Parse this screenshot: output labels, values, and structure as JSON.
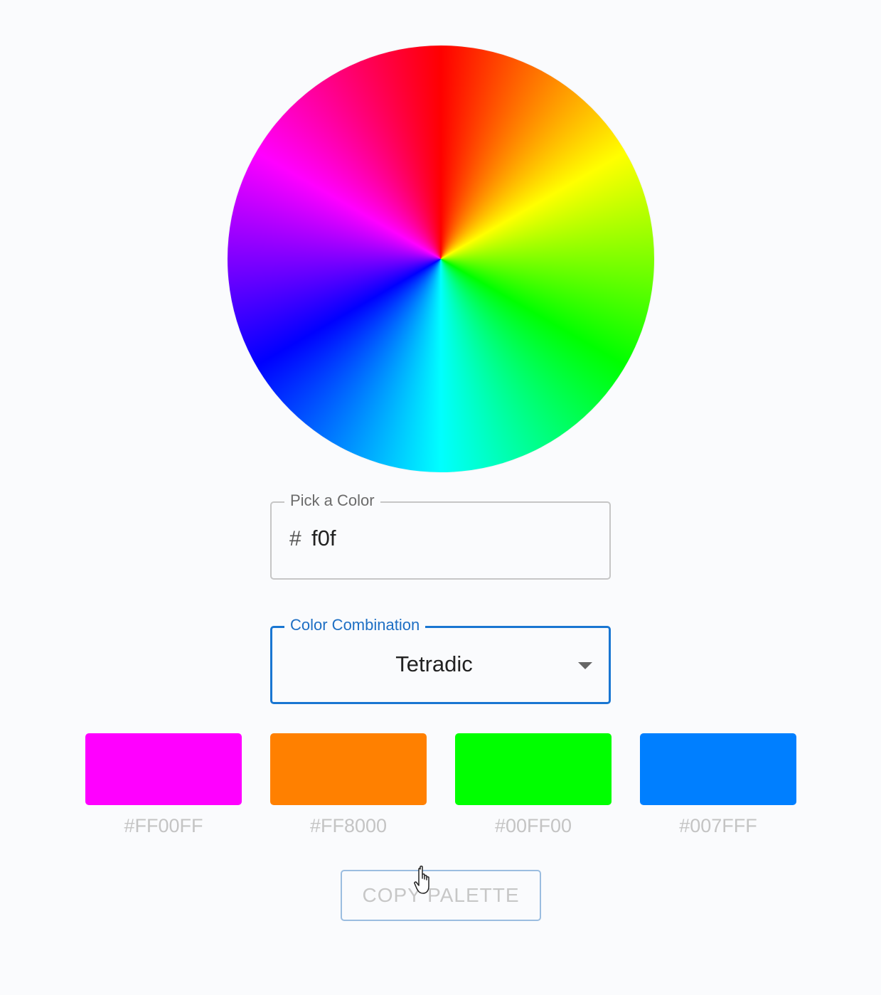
{
  "color_picker": {
    "legend": "Pick a Color",
    "prefix": "#",
    "value": "f0f"
  },
  "combination": {
    "legend": "Color Combination",
    "selected": "Tetradic"
  },
  "palette": [
    {
      "color": "#FF00FF",
      "label": "#FF00FF"
    },
    {
      "color": "#FF8000",
      "label": "#FF8000"
    },
    {
      "color": "#00FF00",
      "label": "#00FF00"
    },
    {
      "color": "#007FFF",
      "label": "#007FFF"
    }
  ],
  "copy_button": {
    "label": "COPY PALETTE"
  },
  "icons": {
    "wheel": "color-wheel",
    "caret": "caret-down-icon",
    "cursor": "hand-pointer-icon"
  },
  "colors": {
    "accent": "#1976d2",
    "background": "#fafbfd"
  }
}
